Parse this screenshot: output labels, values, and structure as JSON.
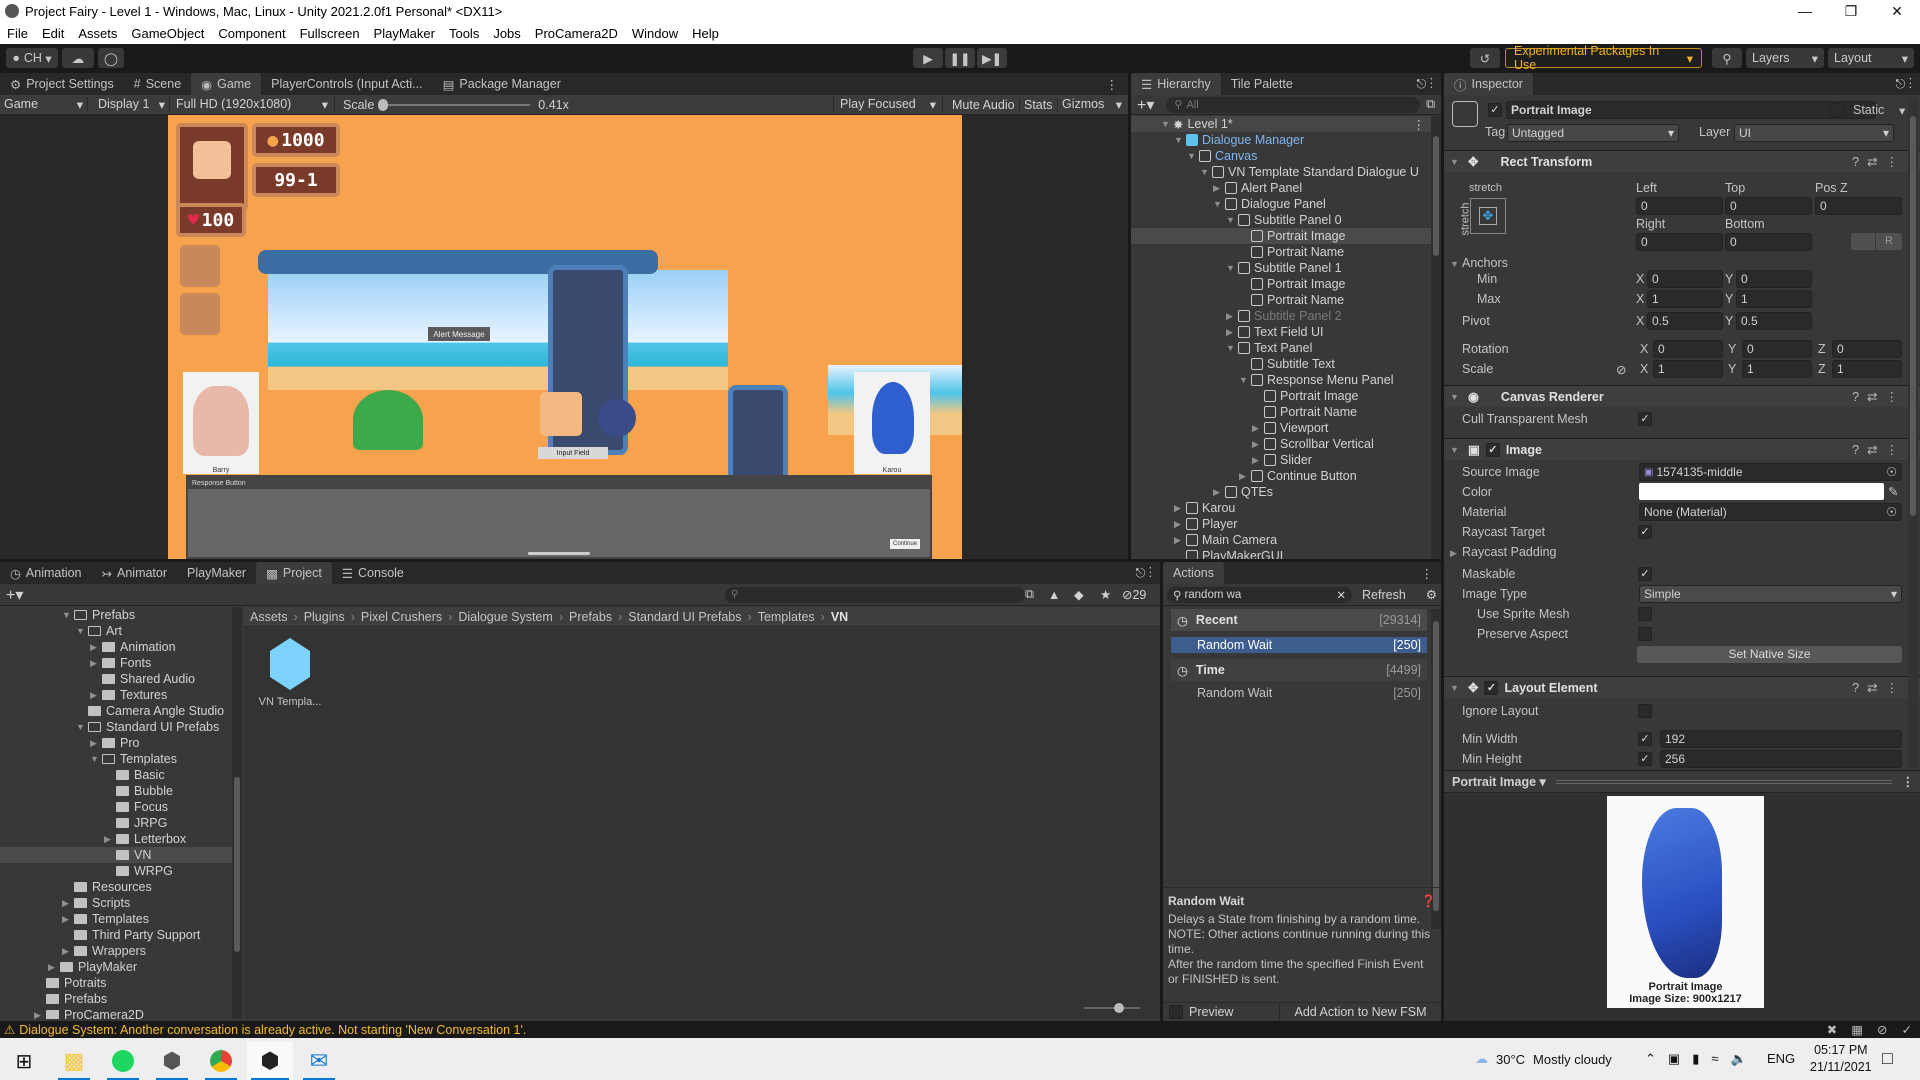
{
  "window": {
    "title": "Project Fairy - Level 1 - Windows, Mac, Linux - Unity 2021.2.0f1 Personal* <DX11>",
    "controls": [
      "minimize",
      "maximize",
      "close"
    ]
  },
  "menu": [
    "File",
    "Edit",
    "Assets",
    "GameObject",
    "Component",
    "Fullscreen",
    "PlayMaker",
    "Tools",
    "Jobs",
    "ProCamera2D",
    "Window",
    "Help"
  ],
  "toolbar": {
    "account": "CH",
    "experimental": "Experimental Packages In Use",
    "layers": "Layers",
    "layout": "Layout"
  },
  "top_tabs": [
    "Project Settings",
    "Scene",
    "Game",
    "PlayerControls (Input Acti...",
    "Package Manager"
  ],
  "game_toolbar": {
    "mode": "Game",
    "display": "Display 1",
    "resolution": "Full HD (1920x1080)",
    "scale_label": "Scale",
    "scale_value": "0.41x",
    "play_mode": "Play Focused",
    "mute": "Mute Audio",
    "stats": "Stats",
    "gizmos": "Gizmos"
  },
  "game_view": {
    "coins": "1000",
    "level": "99-1",
    "health": "100",
    "alert_label": "Alert Message",
    "input_label": "Input Field",
    "response_label": "Response Button",
    "continue_label": "Continue",
    "left_portrait_name": "Barry",
    "right_portrait_name": "Karou"
  },
  "hierarchy": {
    "tabs": [
      "Hierarchy",
      "Tile Palette"
    ],
    "search_placeholder": "All",
    "scene": "Level 1*",
    "items": [
      {
        "label": "Dialogue Manager",
        "depth": 1,
        "arrow": "down",
        "style": "blue",
        "icon": "prefab"
      },
      {
        "label": "Canvas",
        "depth": 2,
        "arrow": "down",
        "style": "blue"
      },
      {
        "label": "VN Template Standard Dialogue U",
        "depth": 3,
        "arrow": "down"
      },
      {
        "label": "Alert Panel",
        "depth": 4,
        "arrow": "right"
      },
      {
        "label": "Dialogue Panel",
        "depth": 4,
        "arrow": "down"
      },
      {
        "label": "Subtitle Panel 0",
        "depth": 5,
        "arrow": "down"
      },
      {
        "label": "Portrait Image",
        "depth": 6,
        "arrow": "",
        "style": "sel"
      },
      {
        "label": "Portrait Name",
        "depth": 6,
        "arrow": ""
      },
      {
        "label": "Subtitle Panel 1",
        "depth": 5,
        "arrow": "down"
      },
      {
        "label": "Portrait Image",
        "depth": 6,
        "arrow": ""
      },
      {
        "label": "Portrait Name",
        "depth": 6,
        "arrow": ""
      },
      {
        "label": "Subtitle Panel 2",
        "depth": 5,
        "arrow": "right",
        "style": "dim"
      },
      {
        "label": "Text Field UI",
        "depth": 5,
        "arrow": "right"
      },
      {
        "label": "Text Panel",
        "depth": 5,
        "arrow": "down"
      },
      {
        "label": "Subtitle Text",
        "depth": 6,
        "arrow": ""
      },
      {
        "label": "Response Menu Panel",
        "depth": 6,
        "arrow": "down"
      },
      {
        "label": "Portrait Image",
        "depth": 7,
        "arrow": ""
      },
      {
        "label": "Portrait Name",
        "depth": 7,
        "arrow": ""
      },
      {
        "label": "Viewport",
        "depth": 7,
        "arrow": "right"
      },
      {
        "label": "Scrollbar Vertical",
        "depth": 7,
        "arrow": "right"
      },
      {
        "label": "Slider",
        "depth": 7,
        "arrow": "right"
      },
      {
        "label": "Continue Button",
        "depth": 6,
        "arrow": "right"
      },
      {
        "label": "QTEs",
        "depth": 4,
        "arrow": "right"
      },
      {
        "label": "Karou",
        "depth": 1,
        "arrow": "right"
      },
      {
        "label": "Player",
        "depth": 1,
        "arrow": "right"
      },
      {
        "label": "Main Camera",
        "depth": 1,
        "arrow": "right"
      },
      {
        "label": "PlayMakerGUI",
        "depth": 1,
        "arrow": ""
      }
    ]
  },
  "inspector": {
    "tab": "Inspector",
    "object_name": "Portrait Image",
    "static_label": "Static",
    "tag_label": "Tag",
    "tag": "Untagged",
    "layer_label": "Layer",
    "layer": "UI",
    "rect_transform": {
      "title": "Rect Transform",
      "anchor_preset_h": "stretch",
      "anchor_preset_v": "stretch",
      "left_label": "Left",
      "left": "0",
      "top_label": "Top",
      "top": "0",
      "posz_label": "Pos Z",
      "posz": "0",
      "right_label": "Right",
      "right": "0",
      "bottom_label": "Bottom",
      "bottom": "0",
      "anchors_label": "Anchors",
      "min_label": "Min",
      "min_x": "0",
      "min_y": "0",
      "max_label": "Max",
      "max_x": "1",
      "max_y": "1",
      "pivot_label": "Pivot",
      "pivot_x": "0.5",
      "pivot_y": "0.5",
      "rotation_label": "Rotation",
      "rot_x": "0",
      "rot_y": "0",
      "rot_z": "0",
      "scale_label": "Scale",
      "scale_x": "1",
      "scale_y": "1",
      "scale_z": "1",
      "r_button": "R"
    },
    "canvas_renderer": {
      "title": "Canvas Renderer",
      "cull_label": "Cull Transparent Mesh",
      "cull": true
    },
    "image": {
      "title": "Image",
      "source_label": "Source Image",
      "source": "1574135-middle",
      "color_label": "Color",
      "color": "#ffffff",
      "material_label": "Material",
      "material": "None (Material)",
      "raycast_label": "Raycast Target",
      "raycast": true,
      "padding_label": "Raycast Padding",
      "maskable_label": "Maskable",
      "maskable": true,
      "type_label": "Image Type",
      "type": "Simple",
      "sprite_mesh_label": "Use Sprite Mesh",
      "sprite_mesh": false,
      "preserve_label": "Preserve Aspect",
      "preserve": false,
      "native_button": "Set Native Size"
    },
    "layout_element": {
      "title": "Layout Element",
      "ignore_label": "Ignore Layout",
      "ignore": false,
      "min_width_label": "Min Width",
      "min_width": "192",
      "min_height_label": "Min Height",
      "min_height": "256"
    },
    "preview": {
      "title": "Portrait Image",
      "caption1": "Portrait Image",
      "caption2": "Image Size: 900x1217"
    }
  },
  "bottom_tabs": [
    "Animation",
    "Animator",
    "PlayMaker",
    "Project",
    "Console"
  ],
  "project": {
    "hidden_count": "29",
    "breadcrumb": [
      "Assets",
      "Plugins",
      "Pixel Crushers",
      "Dialogue System",
      "Prefabs",
      "Standard UI Prefabs",
      "Templates",
      "VN"
    ],
    "tree": [
      {
        "label": "Prefabs",
        "depth": 0,
        "arrow": "down",
        "open": true
      },
      {
        "label": "Art",
        "depth": 1,
        "arrow": "down",
        "open": true
      },
      {
        "label": "Animation",
        "depth": 2,
        "arrow": "right"
      },
      {
        "label": "Fonts",
        "depth": 2,
        "arrow": "right"
      },
      {
        "label": "Shared Audio",
        "depth": 2,
        "arrow": ""
      },
      {
        "label": "Textures",
        "depth": 2,
        "arrow": "right"
      },
      {
        "label": "Camera Angle Studio",
        "depth": 1,
        "arrow": ""
      },
      {
        "label": "Standard UI Prefabs",
        "depth": 1,
        "arrow": "down",
        "open": true
      },
      {
        "label": "Pro",
        "depth": 2,
        "arrow": "right"
      },
      {
        "label": "Templates",
        "depth": 2,
        "arrow": "down",
        "open": true
      },
      {
        "label": "Basic",
        "depth": 3,
        "arrow": ""
      },
      {
        "label": "Bubble",
        "depth": 3,
        "arrow": ""
      },
      {
        "label": "Focus",
        "depth": 3,
        "arrow": ""
      },
      {
        "label": "JRPG",
        "depth": 3,
        "arrow": ""
      },
      {
        "label": "Letterbox",
        "depth": 3,
        "arrow": "right"
      },
      {
        "label": "VN",
        "depth": 3,
        "arrow": "",
        "selected": true
      },
      {
        "label": "WRPG",
        "depth": 3,
        "arrow": ""
      },
      {
        "label": "Resources",
        "depth": 0,
        "arrow": ""
      },
      {
        "label": "Scripts",
        "depth": 0,
        "arrow": "right"
      },
      {
        "label": "Templates",
        "depth": 0,
        "arrow": "right"
      },
      {
        "label": "Third Party Support",
        "depth": 0,
        "arrow": ""
      },
      {
        "label": "Wrappers",
        "depth": 0,
        "arrow": "right"
      },
      {
        "label": "PlayMaker",
        "depth": -1,
        "arrow": "right"
      },
      {
        "label": "Potraits",
        "depth": -2,
        "arrow": ""
      },
      {
        "label": "Prefabs",
        "depth": -2,
        "arrow": ""
      },
      {
        "label": "ProCamera2D",
        "depth": -2,
        "arrow": "right"
      }
    ],
    "asset": "VN Templa..."
  },
  "actions": {
    "tab": "Actions",
    "search": "random wa",
    "refresh": "Refresh",
    "groups": [
      {
        "title": "Recent",
        "count": "[29314]",
        "items": [
          {
            "label": "Random Wait",
            "count": "[250]",
            "selected": true
          }
        ]
      },
      {
        "title": "Time",
        "count": "[4499]",
        "items": [
          {
            "label": "Random Wait",
            "count": "[250]"
          }
        ]
      }
    ],
    "desc_title": "Random Wait",
    "desc": "Delays a State from finishing by a random time.\nNOTE: Other actions continue running during this time.\nAfter the random time the specified Finish Event or FINISHED is sent.",
    "preview": "Preview",
    "add_button": "Add Action to New FSM"
  },
  "status": {
    "message": "Dialogue System: Another conversation is already active. Not starting 'New Conversation 1'."
  },
  "taskbar": {
    "apps": [
      "windows-start",
      "file-explorer",
      "spotify",
      "unity-hub",
      "chrome",
      "unity",
      "mail"
    ],
    "weather": "30°C",
    "weather_desc": "Mostly cloudy",
    "lang": "ENG",
    "time": "05:17 PM",
    "date": "21/11/2021"
  }
}
